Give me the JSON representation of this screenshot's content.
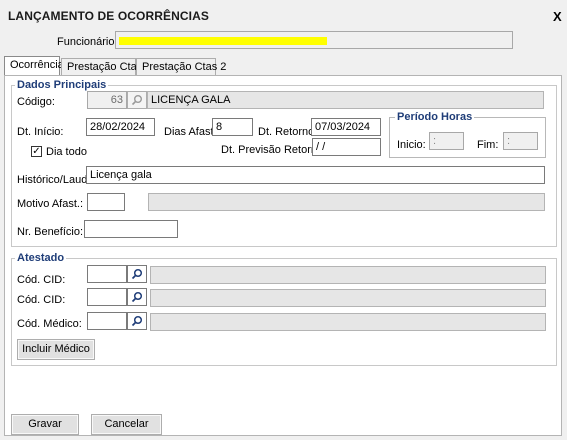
{
  "window": {
    "title": "LANÇAMENTO DE OCORRÊNCIAS",
    "close_label": "X"
  },
  "header": {
    "funcionario_label": "Funcionário:",
    "funcionario_value": ""
  },
  "tabs": [
    {
      "label": "Ocorrência",
      "active": true
    },
    {
      "label": "Prestação Ctas",
      "active": false
    },
    {
      "label": "Prestação Ctas 2",
      "active": false
    }
  ],
  "dados": {
    "group_title": "Dados Principais",
    "codigo_label": "Código:",
    "codigo_value": "63",
    "codigo_desc": "LICENÇA GALA",
    "dt_inicio_label": "Dt. Início:",
    "dt_inicio_value": "28/02/2024",
    "dias_afast_label": "Dias Afast.",
    "dias_afast_value": "8",
    "dt_retorno_label": "Dt. Retorno:",
    "dt_retorno_value": "07/03/2024",
    "dia_todo_label": "Dia todo",
    "dia_todo_checked": true,
    "dt_previsao_label": "Dt. Previsão Retorno:",
    "dt_previsao_value": " / /",
    "historico_label": "Histórico/Laudo:",
    "historico_value": "Licença gala",
    "motivo_label": "Motivo Afast.:",
    "motivo_value": "",
    "motivo_desc": "",
    "nr_beneficio_label": "Nr. Benefício:",
    "nr_beneficio_value": ""
  },
  "periodo": {
    "title": "Período Horas",
    "inicio_label": "Inicio:",
    "inicio_value": ":",
    "fim_label": "Fim:",
    "fim_value": ":"
  },
  "atestado": {
    "group_title": "Atestado",
    "cid1_label": "Cód. CID:",
    "cid1_value": "",
    "cid2_label": "Cód. CID:",
    "cid2_value": "",
    "medico_label": "Cód. Médico:",
    "medico_value": "",
    "incluir_medico_label": "Incluir Médico"
  },
  "footer": {
    "gravar_label": "Gravar",
    "cancelar_label": "Cancelar"
  },
  "colors": {
    "group_title": "#1f3d78",
    "redaction": "#ffff00"
  }
}
